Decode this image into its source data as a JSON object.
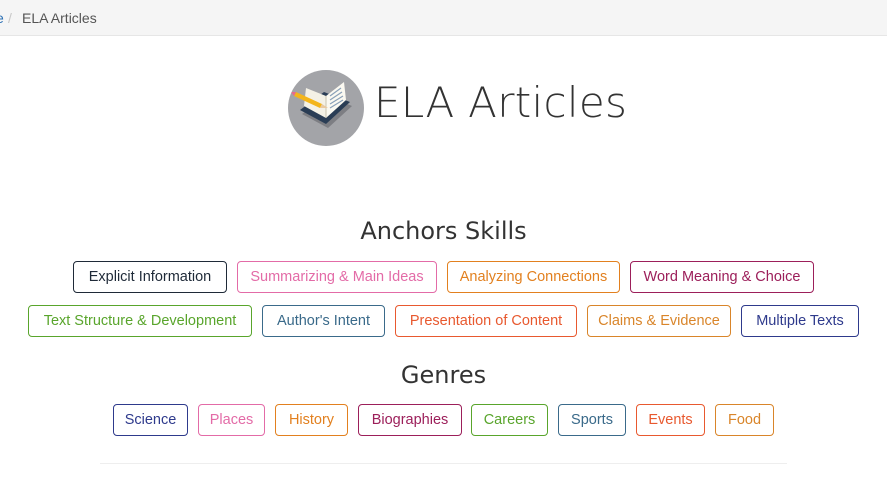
{
  "breadcrumb": {
    "home_fragment": "e",
    "separator": "/",
    "current": "ELA Articles"
  },
  "header": {
    "title": "ELA Articles",
    "icon": "open-book-with-pencil-icon"
  },
  "anchors": {
    "heading": "Anchors Skills",
    "row1": [
      {
        "label": "Explicit Information",
        "color": "#1f2a38"
      },
      {
        "label": "Summarizing & Main Ideas",
        "color": "#e36ba7"
      },
      {
        "label": "Analyzing Connections",
        "color": "#e2801f"
      },
      {
        "label": "Word Meaning & Choice",
        "color": "#9c1f5a"
      }
    ],
    "row2": [
      {
        "label": "Text Structure & Development",
        "color": "#59a52c"
      },
      {
        "label": "Author's Intent",
        "color": "#3a6a8a"
      },
      {
        "label": "Presentation of Content",
        "color": "#e8592f"
      },
      {
        "label": "Claims & Evidence",
        "color": "#d9852a"
      },
      {
        "label": "Multiple Texts",
        "color": "#2e3a8c"
      }
    ]
  },
  "genres": {
    "heading": "Genres",
    "items": [
      {
        "label": "Science",
        "color": "#2e3a8c"
      },
      {
        "label": "Places",
        "color": "#e36ba7"
      },
      {
        "label": "History",
        "color": "#e2801f"
      },
      {
        "label": "Biographies",
        "color": "#9c1f5a"
      },
      {
        "label": "Careers",
        "color": "#59a52c"
      },
      {
        "label": "Sports",
        "color": "#3a6a8a"
      },
      {
        "label": "Events",
        "color": "#e8592f"
      },
      {
        "label": "Food",
        "color": "#d9852a"
      }
    ]
  }
}
